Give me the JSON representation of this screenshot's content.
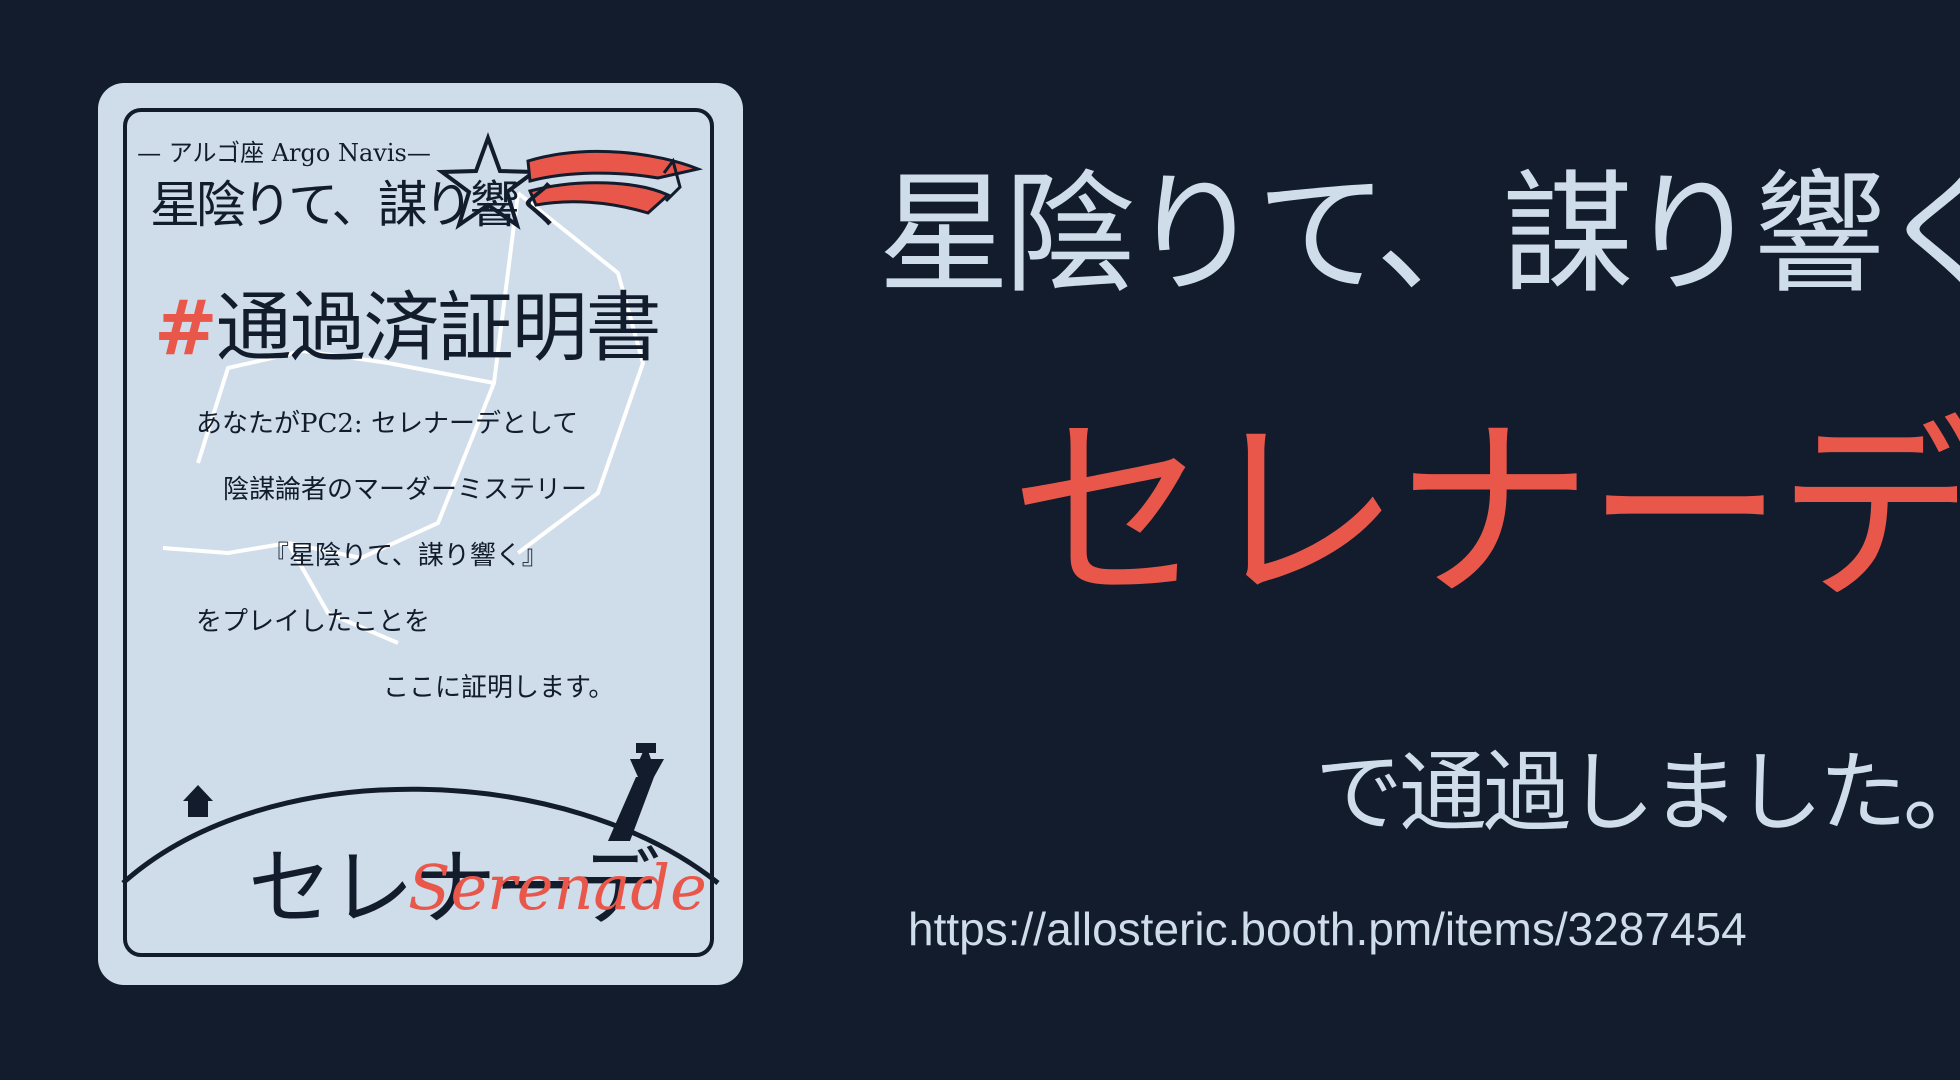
{
  "card": {
    "eyebrow": "— アルゴ座 Argo Navis—",
    "title": "星陰りて、謀り響く",
    "cert_hash": "#",
    "cert_text": "通過済証明書",
    "lines": [
      "あなたがPC2: セレナーデとして",
      "陰謀論者のマーダーミステリー",
      "『星陰りて、謀り響く』",
      "をプレイしたことを",
      "ここに証明します。"
    ],
    "name_ja": "セレナーデ",
    "name_en": "Serenade"
  },
  "main": {
    "title": "星陰りて、謀り響く",
    "role": "セレナーデ",
    "passed": "で通過しました。",
    "url": "https://allosteric.booth.pm/items/3287454"
  },
  "colors": {
    "background": "#121c2c",
    "card": "#cfdcea",
    "accent": "#e8574a",
    "text_light": "#cfdcea",
    "ink": "#121c2c"
  }
}
